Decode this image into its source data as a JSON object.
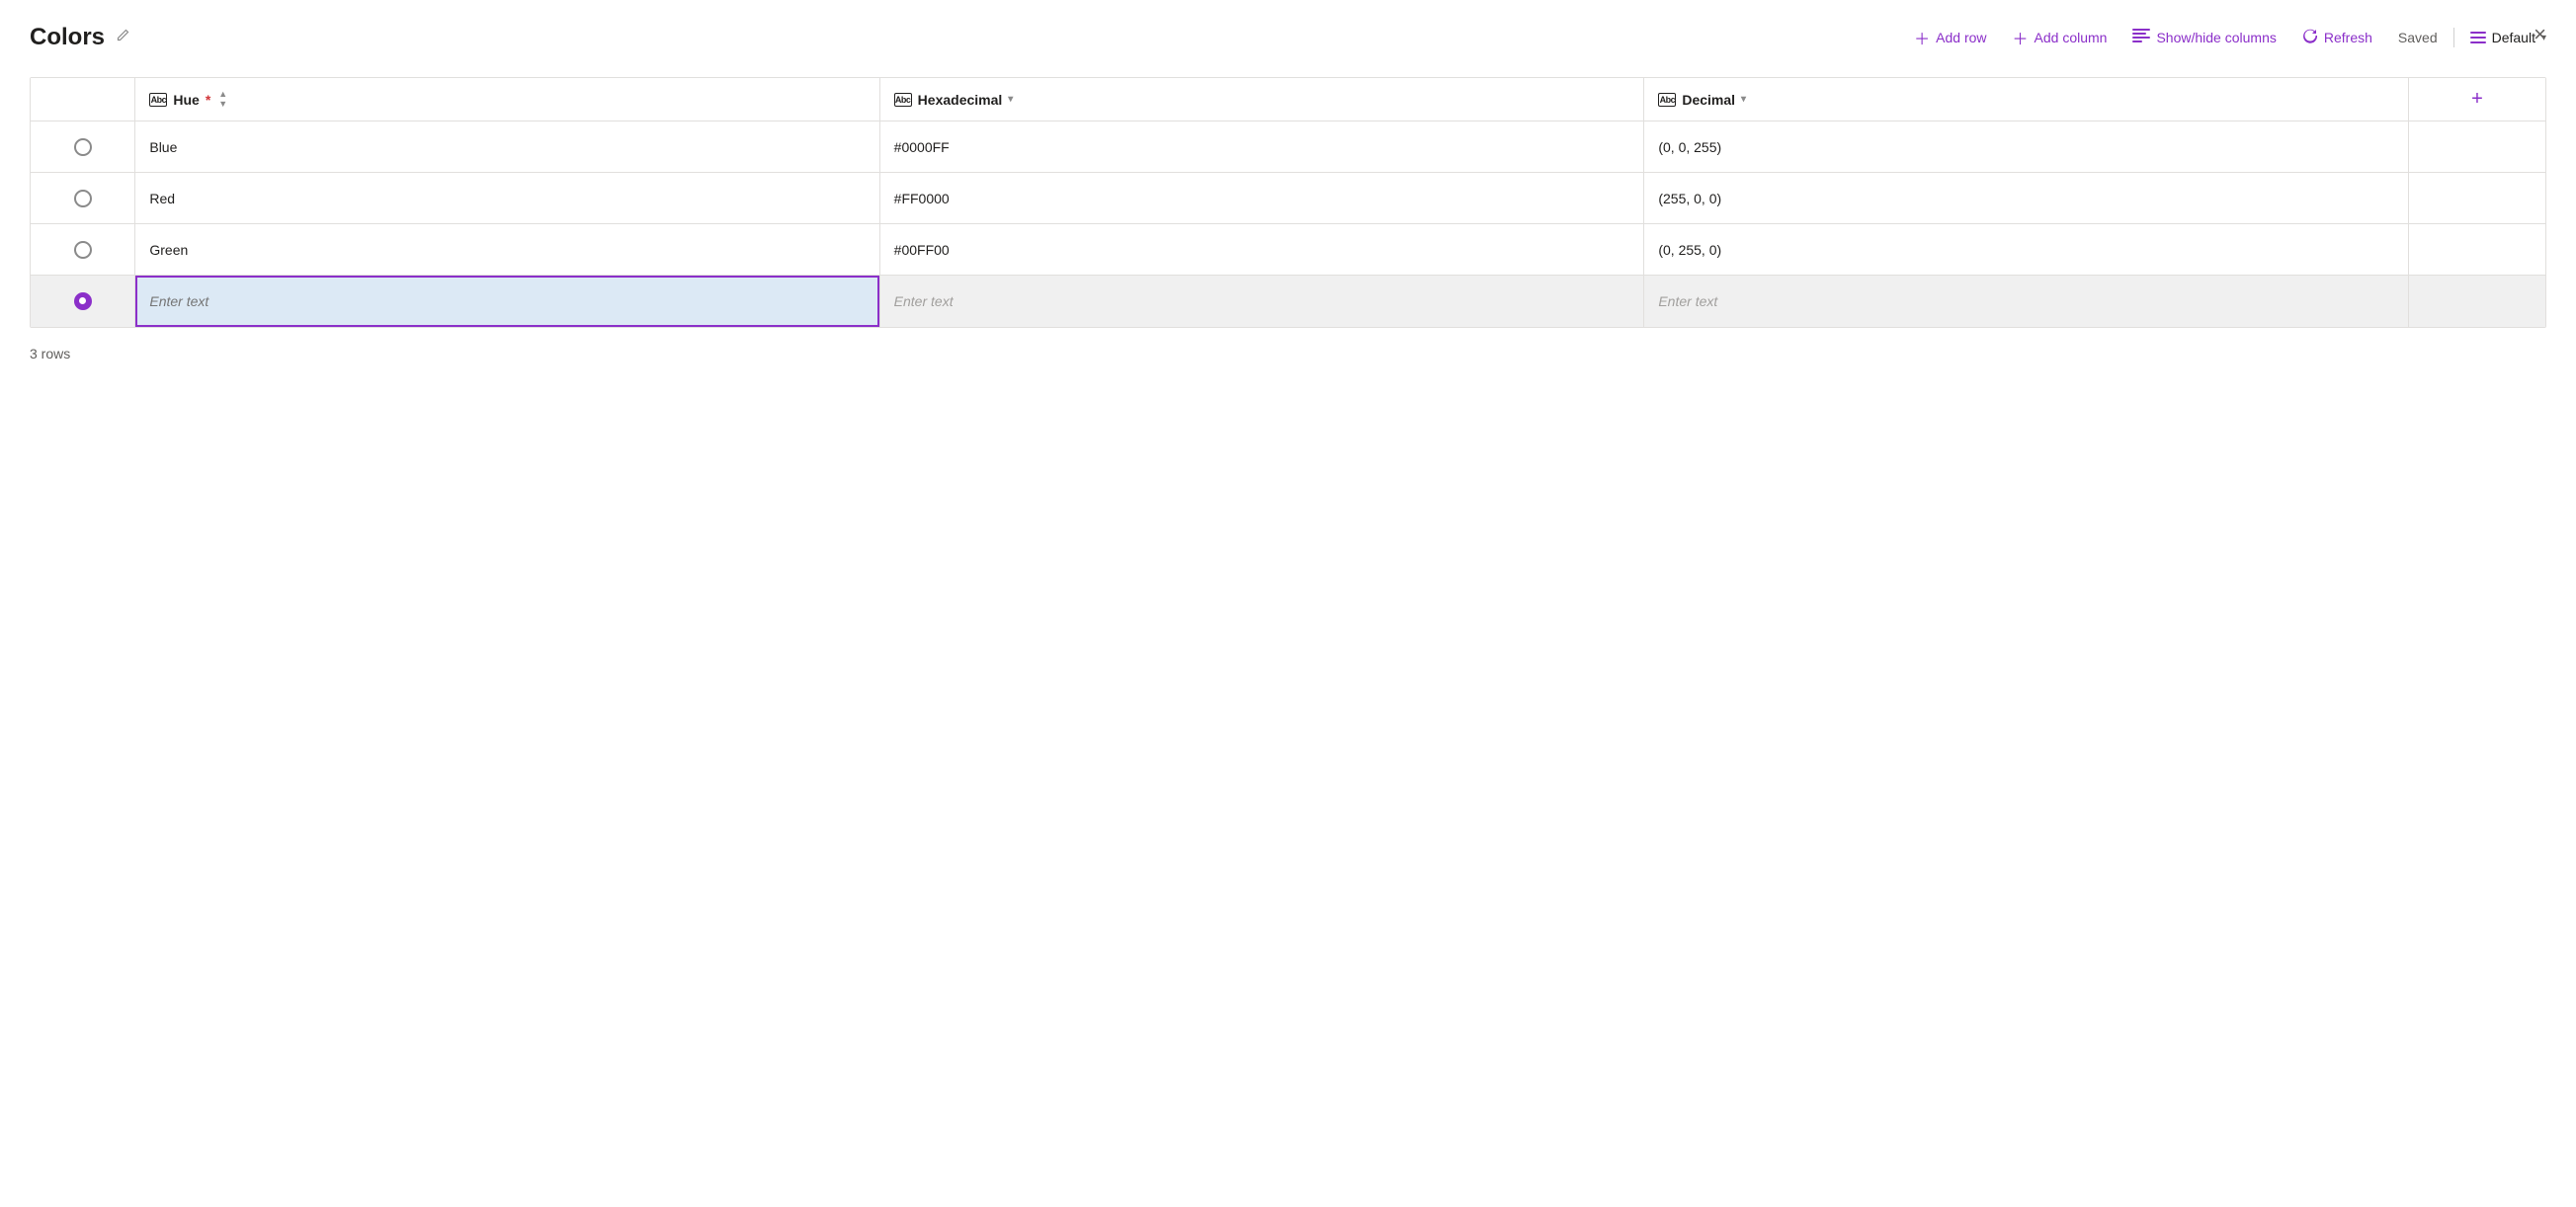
{
  "header": {
    "title": "Colors",
    "close_label": "×"
  },
  "toolbar": {
    "add_row_label": "Add row",
    "add_column_label": "Add column",
    "show_hide_label": "Show/hide columns",
    "refresh_label": "Refresh",
    "saved_label": "Saved",
    "default_label": "Default"
  },
  "table": {
    "columns": [
      {
        "id": "selector",
        "label": ""
      },
      {
        "id": "hue",
        "label": "Hue",
        "required": true,
        "type": "text"
      },
      {
        "id": "hexadecimal",
        "label": "Hexadecimal",
        "type": "text"
      },
      {
        "id": "decimal",
        "label": "Decimal",
        "type": "text"
      },
      {
        "id": "add",
        "label": "+"
      }
    ],
    "rows": [
      {
        "id": 1,
        "hue": "Blue",
        "hexadecimal": "#0000FF",
        "decimal": "(0, 0, 255)",
        "selected": false
      },
      {
        "id": 2,
        "hue": "Red",
        "hexadecimal": "#FF0000",
        "decimal": "(255, 0, 0)",
        "selected": false
      },
      {
        "id": 3,
        "hue": "Green",
        "hexadecimal": "#00FF00",
        "decimal": "(0, 255, 0)",
        "selected": false
      }
    ],
    "new_row": {
      "hue_placeholder": "Enter text",
      "hexadecimal_placeholder": "Enter text",
      "decimal_placeholder": "Enter text",
      "selected": true
    },
    "row_count_label": "3 rows"
  }
}
